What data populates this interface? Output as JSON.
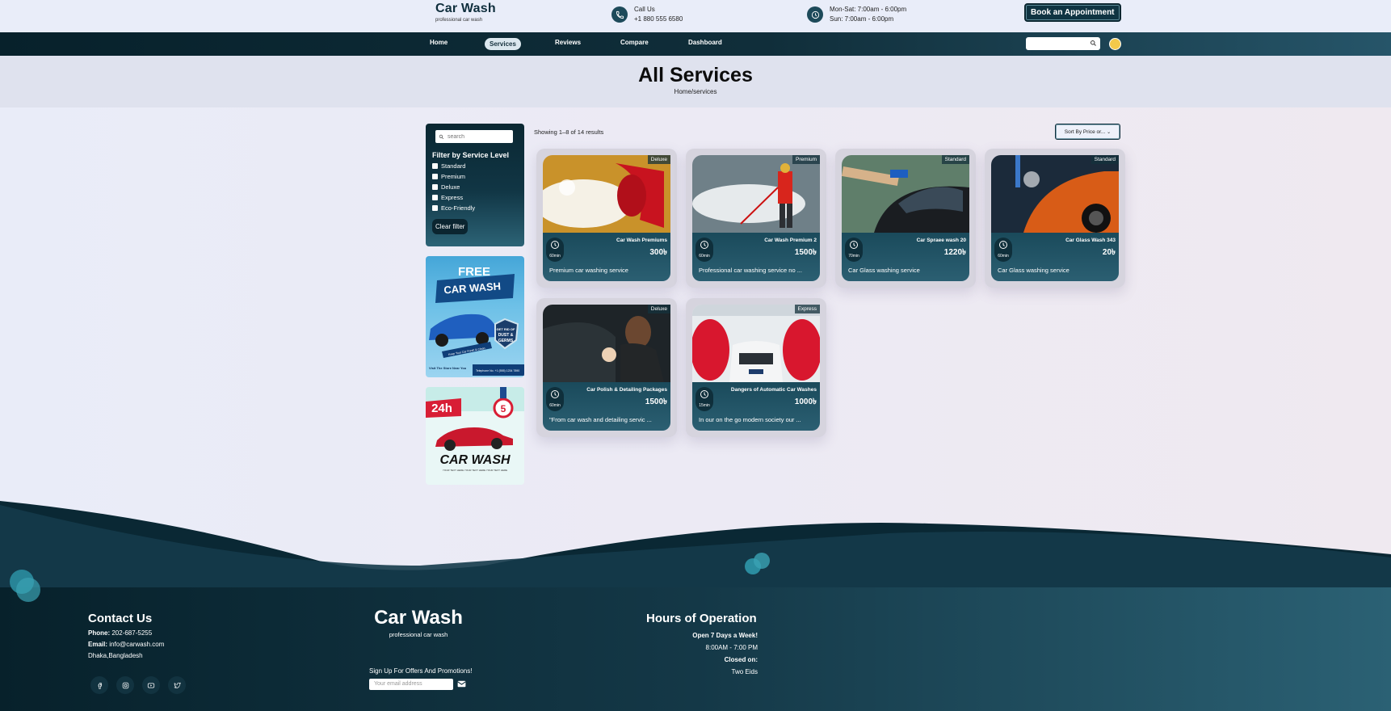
{
  "header": {
    "brand_title": "Car Wash",
    "brand_subtitle": "professional car wash",
    "call_label": "Call Us",
    "call_number": "+1 880 555 6580",
    "hours_line1": "Mon-Sat: 7:00am - 6:00pm",
    "hours_line2": "Sun: 7:00am - 6:00pm",
    "book_button": "Book an Appointment"
  },
  "nav": {
    "items": [
      "Home",
      "Services",
      "Reviews",
      "Compare",
      "Dashboard"
    ],
    "active": "Services"
  },
  "hero": {
    "title": "All Services",
    "breadcrumb": "Home/services"
  },
  "sidebar": {
    "search_placeholder": "search",
    "filter_title": "Filter by Service Level",
    "levels": [
      "Standard",
      "Premium",
      "Deluxe",
      "Express",
      "Eco-Friendly"
    ],
    "clear_button": "Clear filter"
  },
  "promo1": {
    "free": "FREE",
    "carwash": "CAR WASH",
    "shield": "GET RID OF DUST & GERMS",
    "ribbon": "Keep Your Car Fresh & Clean",
    "visit": "Visit The Store Near You",
    "phone": "Telephone No. +1 (555) 1234 7890"
  },
  "promo2": {
    "hours": "24h",
    "badge": "5",
    "title": "CAR WASH",
    "tag": "YOUR TEXT HERE YOUR TEXT HERE YOUR TEXT HERE"
  },
  "listing": {
    "showing": "Showing 1–8 of 14 results",
    "sort": "Sort By Price or..."
  },
  "services": [
    {
      "level": "Deluxe",
      "name": "Car Wash Premiums",
      "price": "300৳",
      "duration": "60min",
      "desc": "Premium car washing service",
      "img": "foam"
    },
    {
      "level": "Premium",
      "name": "Car Wash Premium 2",
      "price": "1500৳",
      "duration": "60min",
      "desc": "Professional car washing service no ...",
      "img": "spray"
    },
    {
      "level": "Standard",
      "name": "Car Spraee wash 20",
      "price": "1220৳",
      "duration": "70min",
      "desc": "Car Glass washing service",
      "img": "hose"
    },
    {
      "level": "Standard",
      "name": "Car Glass Wash 343",
      "price": "20৳",
      "duration": "60min",
      "desc": "Car Glass washing service",
      "img": "orange"
    },
    {
      "level": "Deluxe",
      "name": "Car Polish & Detailing Packages",
      "price": "1500৳",
      "duration": "60min",
      "desc": "\"From car wash and detailing servic ...",
      "img": "polish"
    },
    {
      "level": "Express",
      "name": "Dangers of Automatic Car Washes",
      "price": "1000৳",
      "duration": "15min",
      "desc": "In our on the go modern society our ...",
      "img": "auto"
    }
  ],
  "footer": {
    "contact_title": "Contact Us",
    "phone_label": "Phone:",
    "phone": "202-687-5255",
    "email_label": "Email:",
    "email": "info@carwash.com",
    "address": "Dhaka,Bangladesh",
    "brand_title": "Car Wash",
    "brand_subtitle": "professional car wash",
    "signup_text": "Sign Up For Offers And Promotions!",
    "email_placeholder": "Your email address",
    "hours_title": "Hours of Operation",
    "open_days": "Open 7 Days a Week!",
    "open_hours": "8:00AM - 7:00 PM",
    "closed_label": "Closed on:",
    "closed_days": "Two Eids",
    "social_icons": [
      "facebook-icon",
      "instagram-icon",
      "youtube-icon",
      "twitter-icon"
    ]
  },
  "colors": {
    "dark_teal": "#0f2e3c",
    "nav_gradient_end": "#265569",
    "card_body": "#1a4a5b",
    "accent_blob": "#2b8da0"
  }
}
